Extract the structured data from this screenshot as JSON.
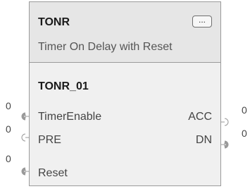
{
  "block": {
    "instruction": "TONR",
    "description": "Timer On Delay with Reset",
    "ellipsis_label": "...",
    "tag": "TONR_01"
  },
  "inputs": [
    {
      "label": "TimerEnable",
      "value": "0"
    },
    {
      "label": "PRE",
      "value": "0"
    },
    {
      "label": "Reset",
      "value": "0"
    }
  ],
  "outputs": [
    {
      "label": "ACC",
      "value": "0"
    },
    {
      "label": "DN",
      "value": "0"
    }
  ]
}
